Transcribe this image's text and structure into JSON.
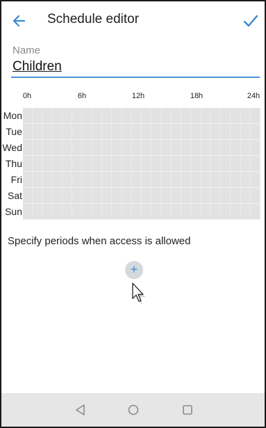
{
  "header": {
    "title": "Schedule editor",
    "back_icon": "arrow-left-icon",
    "confirm_icon": "checkmark-icon",
    "accent_color": "#3a87cf"
  },
  "name_field": {
    "label": "Name",
    "value": "Children"
  },
  "schedule": {
    "hours": [
      "0h",
      "6h",
      "12h",
      "18h",
      "24h"
    ],
    "days": [
      "Mon",
      "Tue",
      "Wed",
      "Thu",
      "Fri",
      "Sat",
      "Sun"
    ],
    "cell_color": "#e2e2e2"
  },
  "hint": "Specify periods when access is allowed",
  "add_button": {
    "symbol": "+",
    "icon": "plus-icon"
  },
  "navbar": {
    "back_icon": "triangle-back-icon",
    "home_icon": "circle-home-icon",
    "recents_icon": "square-recents-icon",
    "background": "#e6e6e6"
  }
}
